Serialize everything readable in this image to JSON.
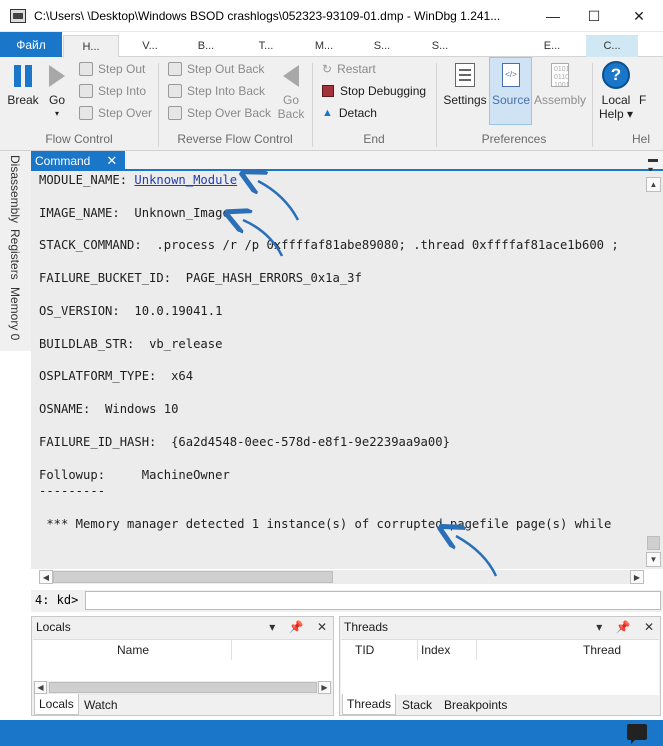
{
  "window": {
    "title": "C:\\Users\\        \\Desktop\\Windows BSOD crashlogs\\052323-93109-01.dmp - WinDbg 1.241...",
    "minimize": "—",
    "maximize": "☐",
    "close": "✕"
  },
  "ribbon_tabs": [
    {
      "label": "Файл"
    },
    {
      "label": "H..."
    },
    {
      "label": "V..."
    },
    {
      "label": "B..."
    },
    {
      "label": "T..."
    },
    {
      "label": "M..."
    },
    {
      "label": "S..."
    },
    {
      "label": "S..."
    },
    {
      "label": "E..."
    },
    {
      "label": "C..."
    }
  ],
  "ribbon": {
    "break": "Break",
    "go": "Go",
    "step_out": "Step Out",
    "step_into": "Step Into",
    "step_over": "Step Over",
    "step_out_back": "Step Out Back",
    "step_into_back": "Step Into Back",
    "step_over_back": "Step Over Back",
    "go_back_1": "Go",
    "go_back_2": "Back",
    "restart": "Restart",
    "stop_debugging": "Stop Debugging",
    "detach": "Detach",
    "settings": "Settings",
    "source": "Source",
    "assembly": "Assembly",
    "local_help_1": "Local",
    "local_help_2": "Help",
    "more_1": "F",
    "more_2": "",
    "groups": {
      "flow_control": "Flow Control",
      "reverse_flow_control": "Reverse Flow Control",
      "end": "End",
      "preferences": "Preferences",
      "help": "Hel"
    }
  },
  "side_tabs": [
    "Disassembly",
    "Registers",
    "Memory 0"
  ],
  "command": {
    "tab_label": "Command",
    "lines": [
      {
        "key": "MODULE_NAME: ",
        "value": "Unknown_Module",
        "link": true
      },
      {
        "key": "IMAGE_NAME:  ",
        "value": "Unknown_Image"
      },
      {
        "key": "STACK_COMMAND:  ",
        "value": ".process /r /p 0xffffaf81abe89080; .thread 0xffffaf81ace1b600 ;"
      },
      {
        "key": "FAILURE_BUCKET_ID:  ",
        "value": "PAGE_HASH_ERRORS_0x1a_3f"
      },
      {
        "key": "OS_VERSION:  ",
        "value": "10.0.19041.1"
      },
      {
        "key": "BUILDLAB_STR:  ",
        "value": "vb_release"
      },
      {
        "key": "OSPLATFORM_TYPE:  ",
        "value": "x64"
      },
      {
        "key": "OSNAME:  ",
        "value": "Windows 10"
      },
      {
        "key": "FAILURE_ID_HASH:  ",
        "value": "{6a2d4548-0eec-578d-e8f1-9e2239aa9a00}"
      },
      {
        "key": "Followup:     ",
        "value": "MachineOwner"
      },
      {
        "key": "---------",
        "value": ""
      },
      {
        "key": " *** Memory manager detected 1 instance(s) of corrupted pagefile page(s) while",
        "value": ""
      }
    ],
    "prompt": "4: kd>",
    "input_value": ""
  },
  "locals_panel": {
    "title": "Locals",
    "columns": [
      "Name"
    ],
    "tabs": [
      "Locals",
      "Watch"
    ]
  },
  "threads_panel": {
    "title": "Threads",
    "columns": [
      "TID",
      "Index",
      "Thread"
    ],
    "tabs": [
      "Threads",
      "Stack",
      "Breakpoints"
    ]
  },
  "colors": {
    "accent": "#1976c9",
    "annotation_arrow": "#2a6fb8"
  }
}
